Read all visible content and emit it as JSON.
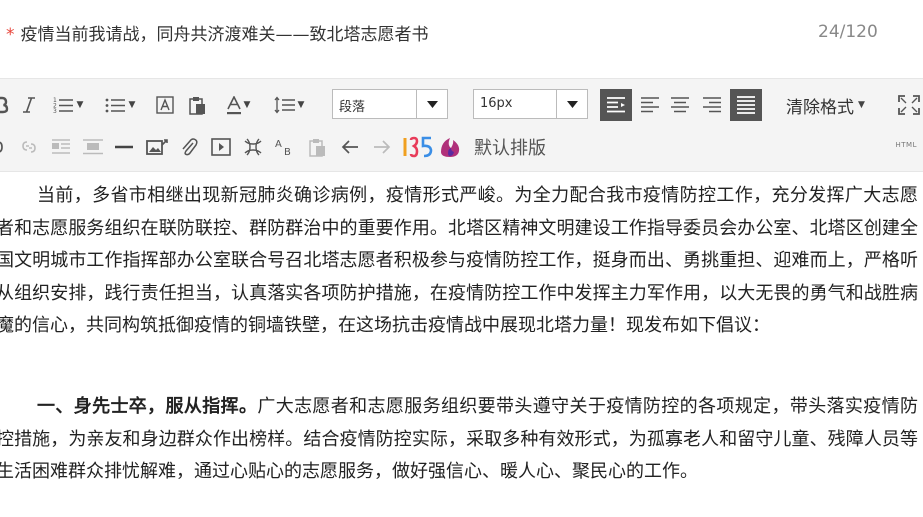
{
  "title_row": {
    "required_mark": "*",
    "title_value": "疫情当前我请战，同舟共济渡难关——致北塔志愿者书",
    "char_count": "24/120"
  },
  "toolbar": {
    "paragraph_select": "段落",
    "fontsize_select": "16px",
    "clear_format": "清除格式",
    "default_layout": "默认排版",
    "html_label": "HTML"
  },
  "content": {
    "paragraph1": "当前，多省市相继出现新冠肺炎确诊病例，疫情形式严峻。为全力配合我市疫情防控工作，充分发挥广大志愿者和志愿服务组织在联防联控、群防群治中的重要作用。北塔区精神文明建设工作指导委员会办公室、北塔区创建全国文明城市工作指挥部办公室联合号召北塔志愿者积极参与疫情防控工作，挺身而出、勇挑重担、迎难而上，严格听从组织安排，践行责任担当，认真落实各项防护措施，在疫情防控工作中发挥主力军作用，以大无畏的勇气和战胜病魔的信心，共同构筑抵御疫情的铜墙铁壁，在这场抗击疫情战中展现北塔力量！现发布如下倡议：",
    "paragraph2_heading": "一、身先士卒，服从指挥。",
    "paragraph2_body": "广大志愿者和志愿服务组织要带头遵守关于疫情防控的各项规定，带头落实疫情防控措施，为亲友和身边群众作出榜样。结合疫情防控实际，采取多种有效形式，为孤寡老人和留守儿童、残障人员等生活困难群众排忧解难，通过心贴心的志愿服务，做好强信心、暖人心、聚民心的工作。"
  }
}
